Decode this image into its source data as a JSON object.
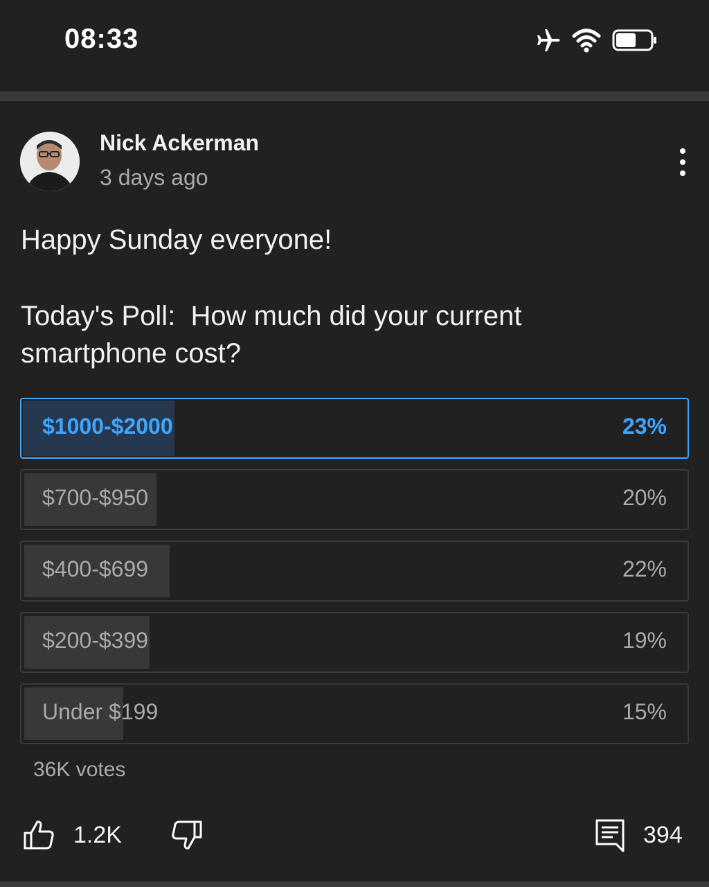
{
  "status_bar": {
    "time": "08:33",
    "icons": [
      "airplane-icon",
      "wifi-icon",
      "battery-icon"
    ]
  },
  "post": {
    "author": "Nick Ackerman",
    "time": "3 days ago",
    "text_line1": "Happy Sunday everyone!",
    "text_line2": "Today's Poll:  How much did your current",
    "text_line3": "smartphone cost?",
    "poll": {
      "options": [
        {
          "label": "$1000-$2000",
          "percent": "23%",
          "fraction": 0.23,
          "selected": true
        },
        {
          "label": "$700-$950",
          "percent": "20%",
          "fraction": 0.2,
          "selected": false
        },
        {
          "label": "$400-$699",
          "percent": "22%",
          "fraction": 0.22,
          "selected": false
        },
        {
          "label": "$200-$399",
          "percent": "19%",
          "fraction": 0.19,
          "selected": false
        },
        {
          "label": "Under $199",
          "percent": "15%",
          "fraction": 0.15,
          "selected": false
        }
      ],
      "votes": "36K votes"
    },
    "actions": {
      "likes": "1.2K",
      "comments": "394"
    }
  },
  "colors": {
    "background": "#212121",
    "accent": "#3ea6ff",
    "selected_fill": "#263850",
    "option_fill": "#383838",
    "border": "#3a3a3a",
    "secondary_text": "#aaaaaa"
  }
}
